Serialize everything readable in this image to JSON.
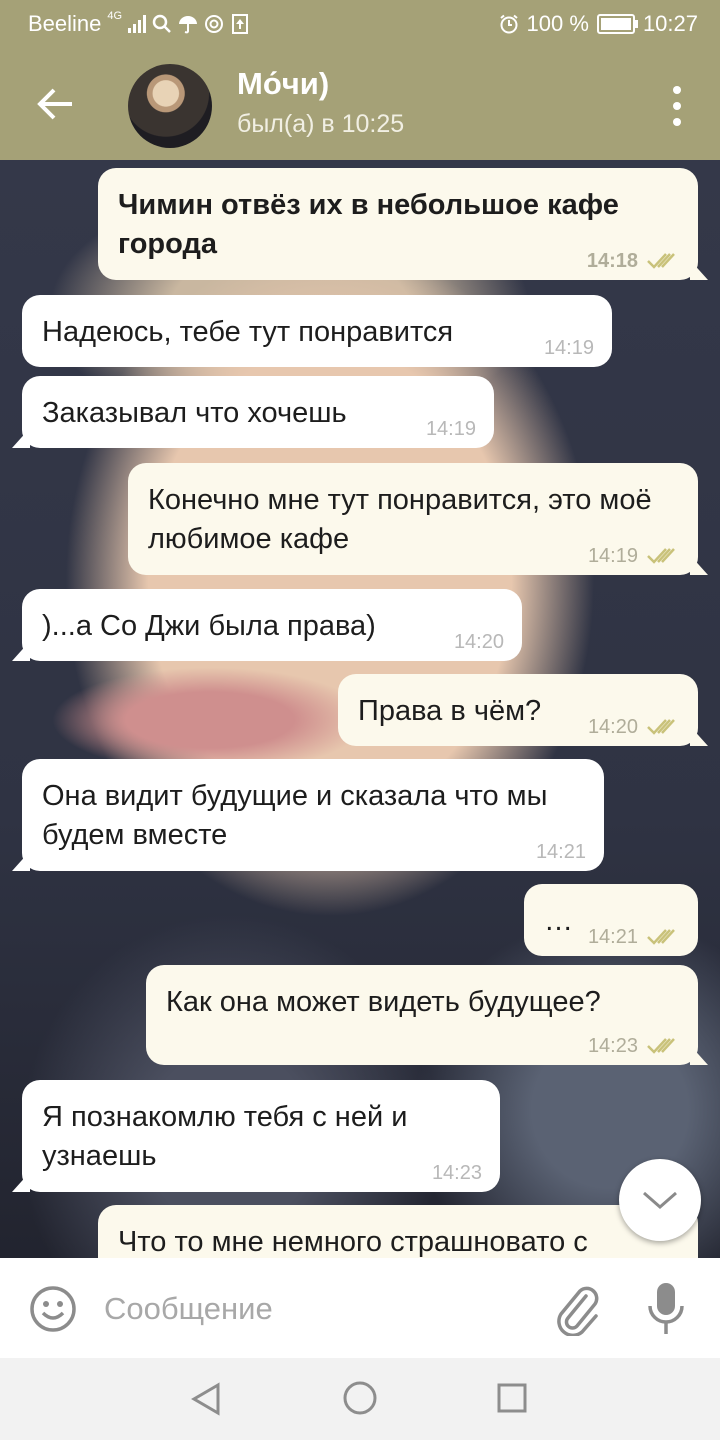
{
  "status_bar": {
    "carrier": "Beeline",
    "network": "4G",
    "battery_text": "100 %",
    "time": "10:27",
    "icons": [
      "signal-icon",
      "search-icon",
      "umbrella-icon",
      "at-icon",
      "upload-icon",
      "alarm-icon",
      "battery-icon"
    ]
  },
  "header": {
    "title": "Мо́чи)",
    "subtitle": "был(а) в 10:25",
    "accent_color": "#a5a177"
  },
  "messages": [
    {
      "direction": "out",
      "text": "Чимин отвёз их в небольшое кафе города",
      "time": "14:18",
      "bold": true,
      "read": true
    },
    {
      "direction": "in",
      "text": "Надеюсь, тебе тут понравится",
      "time": "14:19"
    },
    {
      "direction": "in",
      "text": "Заказывал что хочешь",
      "time": "14:19"
    },
    {
      "direction": "out",
      "text": "Конечно мне тут понравится, это моё любимое кафе",
      "time": "14:19",
      "read": true
    },
    {
      "direction": "in",
      "text": ")...а Со Джи была права)",
      "time": "14:20"
    },
    {
      "direction": "out",
      "text": "Права в чём?",
      "time": "14:20",
      "read": true
    },
    {
      "direction": "in",
      "text": "Она видит будущие и сказала что мы будем вместе",
      "time": "14:21"
    },
    {
      "direction": "out",
      "text": "…",
      "time": "14:21",
      "read": true
    },
    {
      "direction": "out",
      "text": "Как она может видеть будущее?",
      "time": "14:23",
      "read": true
    },
    {
      "direction": "in",
      "text": "Я познакомлю тебя с ней и узнаешь",
      "time": "14:23"
    },
    {
      "direction": "out",
      "text": "Что то мне немного страшновато с",
      "time": ""
    }
  ],
  "composer": {
    "placeholder": "Сообщение"
  },
  "colors": {
    "incoming_bubble": "#ffffff",
    "outgoing_bubble": "#fcf9ec",
    "read_ticks": "#c9c27a"
  }
}
